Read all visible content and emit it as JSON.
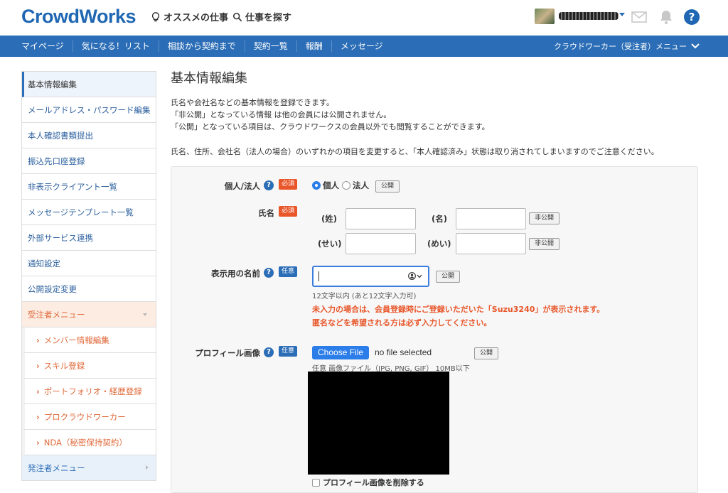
{
  "header": {
    "logo": "CrowdWorks",
    "recommend_link": "オススメの仕事",
    "search_link": "仕事を探す"
  },
  "nav": {
    "items": [
      "マイページ",
      "気になる！リスト",
      "相談から契約まで",
      "契約一覧",
      "報酬",
      "メッセージ"
    ],
    "right_menu": "クラウドワーカー（受注者）メニュー"
  },
  "sidebar": {
    "items": [
      "基本情報編集",
      "メールアドレス・パスワード編集",
      "本人確認書類提出",
      "振込先口座登録",
      "非表示クライアント一覧",
      "メッセージテンプレート一覧",
      "外部サービス連携",
      "通知設定",
      "公開設定変更"
    ],
    "worker_menu": "受注者メニュー",
    "worker_subitems": [
      "メンバー情報編集",
      "スキル登録",
      "ポートフォリオ・経歴登録",
      "プロクラウドワーカー",
      "NDA（秘密保持契約）"
    ],
    "client_menu": "発注者メニュー"
  },
  "main": {
    "title": "基本情報編集",
    "intro": [
      "氏名や会社名などの基本情報を登録できます。",
      "「非公開」となっている情報 は他の会員には公開されません。",
      "「公開」となっている項目は、クラウドワークスの会員以外でも閲覧することができます。"
    ],
    "notice": "氏名、住所、会社名（法人の場合）のいずれかの項目を変更すると、「本人確認済み」状態は取り消されてしまいますのでご注意ください。"
  },
  "form": {
    "type_label": "個人/法人",
    "required_badge": "必須",
    "optional_badge": "任意",
    "radio_individual": "個人",
    "radio_corporate": "法人",
    "public_label": "公開",
    "private_label": "非公開",
    "name_label": "氏名",
    "last_name": "(姓)",
    "first_name": "(名)",
    "last_kana": "(せい)",
    "first_kana": "(めい)",
    "display_label": "表示用の名前",
    "display_hint": "12文字以内 (あと12文字入力可)",
    "display_warn1": "未入力の場合は、会員登録時にご登録いただいた「Suzu3240」が表示されます。",
    "display_warn2": "匿名などを希望される方は必ず入力してください。",
    "profile_label": "プロフィール画像",
    "file_button": "Choose File",
    "file_status": "no file selected",
    "file_hint": "任意 画像ファイル（JPG, PNG, GIF） 10MB以下",
    "delete_label": "プロフィール画像を削除する"
  },
  "colors": {
    "brand": "#2b6db6",
    "required": "#e8562a",
    "link": "#2b5f9e"
  }
}
